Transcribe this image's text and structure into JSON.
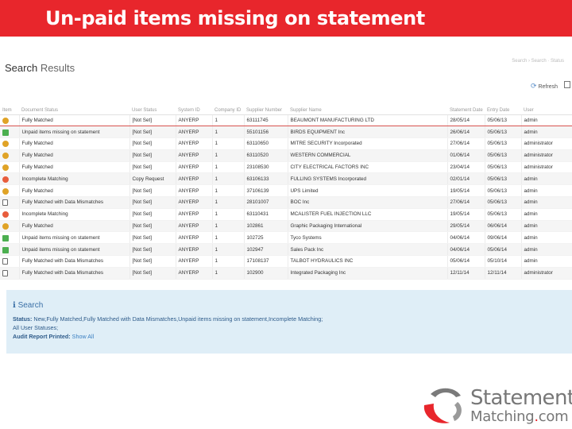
{
  "banner": {
    "title": "Un-paid items missing on statement"
  },
  "results": {
    "title_bold": "Search",
    "title_light": " Results",
    "breadcrumb": "Search › Search · Status",
    "refresh_label": "Refresh"
  },
  "table": {
    "columns": [
      "Item",
      "Document Status",
      "User Status",
      "System ID",
      "Company ID",
      "Supplier Number",
      "Supplier Name",
      "Statement Date",
      "Entry Date",
      "User"
    ],
    "rows": [
      {
        "icon": "gear",
        "status": "Fully Matched",
        "user_status": "[Not Set]",
        "system": "ANYERP",
        "company": "1",
        "supplier_no": "63111745",
        "supplier_name": "BEAUMONT MANUFACTURING LTD",
        "statement_date": "28/05/14",
        "entry_date": "05/06/13",
        "user": "admin",
        "highlight": true
      },
      {
        "icon": "flag",
        "status": "Unpaid items missing on statement",
        "user_status": "[Not Set]",
        "system": "ANYERP",
        "company": "1",
        "supplier_no": "55101156",
        "supplier_name": "BIRDS EQUIPMENT Inc",
        "statement_date": "26/06/14",
        "entry_date": "05/06/13",
        "user": "admin"
      },
      {
        "icon": "gear",
        "status": "Fully Matched",
        "user_status": "[Not Set]",
        "system": "ANYERP",
        "company": "1",
        "supplier_no": "63110650",
        "supplier_name": "MITRE SECURITY Incorporated",
        "statement_date": "27/06/14",
        "entry_date": "05/06/13",
        "user": "administrator"
      },
      {
        "icon": "gear",
        "status": "Fully Matched",
        "user_status": "[Not Set]",
        "system": "ANYERP",
        "company": "1",
        "supplier_no": "63110520",
        "supplier_name": "WESTERN COMMERCIAL",
        "statement_date": "01/06/14",
        "entry_date": "05/06/13",
        "user": "administrator"
      },
      {
        "icon": "gear",
        "status": "Fully Matched",
        "user_status": "[Not Set]",
        "system": "ANYERP",
        "company": "1",
        "supplier_no": "23108530",
        "supplier_name": "CITY ELECTRICAL FACTORS INC",
        "statement_date": "23/04/14",
        "entry_date": "05/06/13",
        "user": "administrator"
      },
      {
        "icon": "warn",
        "status": "Incomplete Matching",
        "user_status": "Copy Request",
        "system": "ANYERP",
        "company": "1",
        "supplier_no": "63106133",
        "supplier_name": "FULLING SYSTEMS Incorporated",
        "statement_date": "02/01/14",
        "entry_date": "05/06/13",
        "user": "admin"
      },
      {
        "icon": "gear",
        "status": "Fully Matched",
        "user_status": "[Not Set]",
        "system": "ANYERP",
        "company": "1",
        "supplier_no": "37106139",
        "supplier_name": "UPS Limited",
        "statement_date": "19/05/14",
        "entry_date": "05/06/13",
        "user": "admin"
      },
      {
        "icon": "doc",
        "status": "Fully Matched with Data Mismatches",
        "user_status": "[Not Set]",
        "system": "ANYERP",
        "company": "1",
        "supplier_no": "28101007",
        "supplier_name": "BOC Inc",
        "statement_date": "27/06/14",
        "entry_date": "05/06/13",
        "user": "admin"
      },
      {
        "icon": "warn",
        "status": "Incomplete Matching",
        "user_status": "[Not Set]",
        "system": "ANYERP",
        "company": "1",
        "supplier_no": "63110431",
        "supplier_name": "MCALISTER FUEL INJECTION LLC",
        "statement_date": "19/05/14",
        "entry_date": "05/06/13",
        "user": "admin"
      },
      {
        "icon": "gear",
        "status": "Fully Matched",
        "user_status": "[Not Set]",
        "system": "ANYERP",
        "company": "1",
        "supplier_no": "102861",
        "supplier_name": "Graphic Packaging International",
        "statement_date": "29/05/14",
        "entry_date": "06/06/14",
        "user": "admin"
      },
      {
        "icon": "flag",
        "status": "Unpaid items missing on statement",
        "user_status": "[Not Set]",
        "system": "ANYERP",
        "company": "1",
        "supplier_no": "102725",
        "supplier_name": "Tyco Systems",
        "statement_date": "04/06/14",
        "entry_date": "09/06/14",
        "user": "admin"
      },
      {
        "icon": "flag",
        "status": "Unpaid items missing on statement",
        "user_status": "[Not Set]",
        "system": "ANYERP",
        "company": "1",
        "supplier_no": "102947",
        "supplier_name": "Sales Pack Inc",
        "statement_date": "04/06/14",
        "entry_date": "05/06/14",
        "user": "admin"
      },
      {
        "icon": "doc",
        "status": "Fully Matched with Data Mismatches",
        "user_status": "[Not Set]",
        "system": "ANYERP",
        "company": "1",
        "supplier_no": "17108137",
        "supplier_name": "TALBOT HYDRAULICS INC",
        "statement_date": "05/06/14",
        "entry_date": "05/10/14",
        "user": "admin"
      },
      {
        "icon": "doc",
        "status": "Fully Matched with Data Mismatches",
        "user_status": "[Not Set]",
        "system": "ANYERP",
        "company": "1",
        "supplier_no": "102900",
        "supplier_name": "Integrated Packaging Inc",
        "statement_date": "12/11/14",
        "entry_date": "12/11/14",
        "user": "administrator"
      }
    ]
  },
  "search_panel": {
    "heading": "Search",
    "status_label": "Status:",
    "status_value": " New,Fully Matched,Fully Matched with Data Mismatches,Unpaid items missing on statement,Incomplete Matching;",
    "user_statuses_label": "All User Statuses;",
    "audit_label": "Audit Report Printed:",
    "audit_value": " Show All"
  },
  "logo": {
    "line1": "Statement",
    "line2_main": "Matching",
    "line2_dot": ".",
    "line2_tld": "com"
  },
  "colors": {
    "brand_red": "#e8262c",
    "panel_blue": "#dfeef7",
    "logo_gray": "#777777"
  }
}
